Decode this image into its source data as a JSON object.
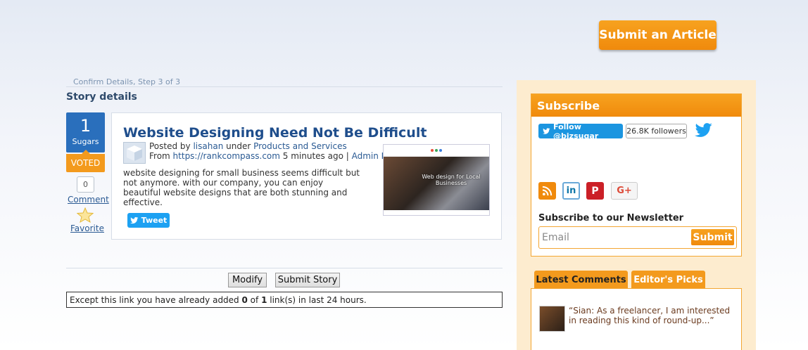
{
  "header": {
    "submit_article_label": "Submit an Article"
  },
  "breadcrumb": {
    "step": "Confirm Details, Step 3 of 3"
  },
  "section": {
    "title": "Story details"
  },
  "vote": {
    "count": "1",
    "label": "Sugars",
    "voted": "VOTED",
    "comment_count": "0",
    "comment_label": "Comment",
    "favorite_label": "Favorite"
  },
  "story": {
    "title": "Website Designing Need Not Be Difficult",
    "posted_by_prefix": "Posted by ",
    "author": "lisahan",
    "under": " under ",
    "category": "Products and Services",
    "from_prefix": "From ",
    "source_url": "https://rankcompass.com",
    "time_ago": " 5 minutes ago | ",
    "admin_links": "Admin Links",
    "excerpt": "website designing for small business seems difficult but not anymore. with our company, you can enjoy beautiful website designs that are both stunning and effective.",
    "thumbnail_caption": "Web design for Local Businesses",
    "tweet_label": "Tweet"
  },
  "actions": {
    "modify_label": "Modify",
    "submit_story_label": "Submit Story"
  },
  "notice": {
    "prefix": "Except this link you have already added ",
    "added": "0",
    "of": " of ",
    "limit": "1",
    "suffix": " link(s) in last 24 hours."
  },
  "sidebar": {
    "subscribe_title": "Subscribe",
    "follow_label": "Follow @bizsugar",
    "followers": "26.8K followers",
    "social_icons": [
      "rss-icon",
      "linkedin-icon",
      "pinterest-icon",
      "google-plus-icon"
    ],
    "newsletter_label": "Subscribe to our Newsletter",
    "email_placeholder": "Email",
    "email_submit": "Submit",
    "tabs": [
      "Latest Comments",
      "Editor's Picks"
    ],
    "latest_comment": "“Sian: As a freelancer, I am interested in reading this kind of round-up...”"
  },
  "colors": {
    "accent_orange": "#f39a1d",
    "link_blue": "#2a5a93",
    "vote_blue": "#2a6fbc",
    "twitter_blue": "#1da1f2"
  }
}
